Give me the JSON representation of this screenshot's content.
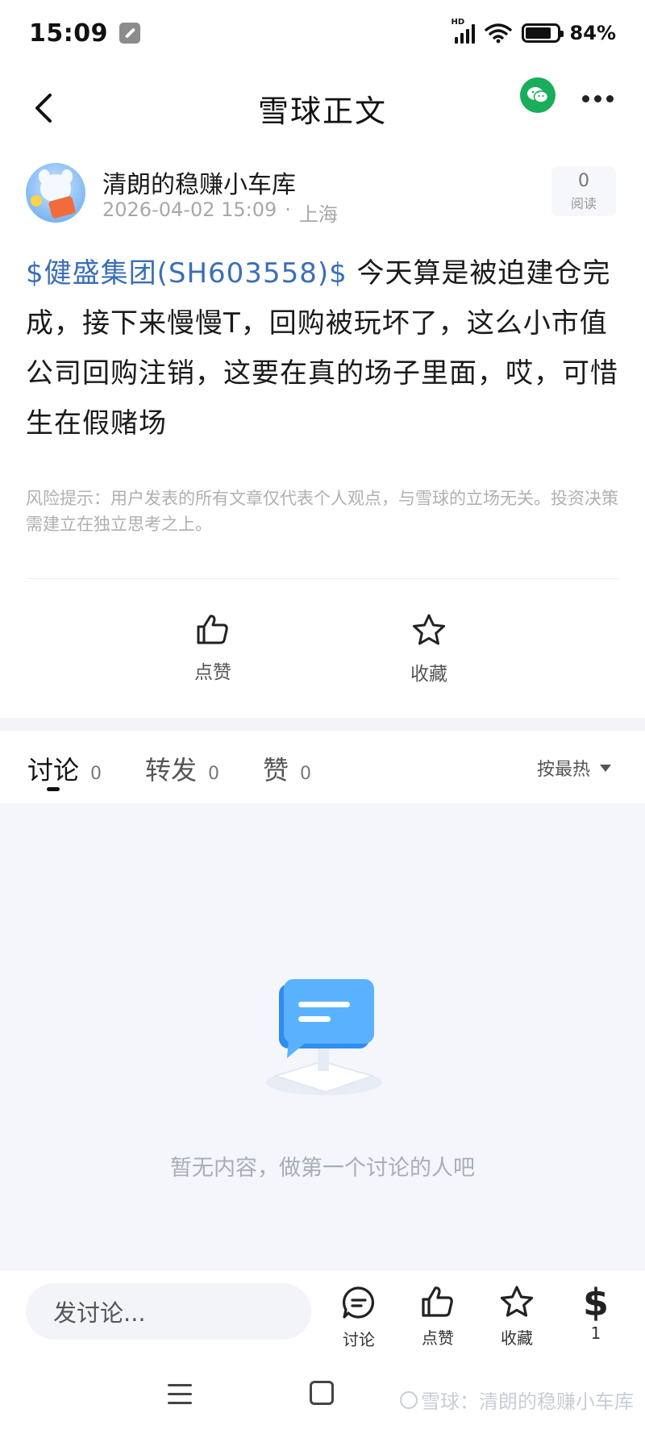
{
  "status_bar": {
    "time": "15:09",
    "network": "HD",
    "battery": "84%"
  },
  "header": {
    "title": "雪球正文"
  },
  "author": {
    "name": "清朗的稳赚小车库",
    "date": "2026-04-02 15:09",
    "separator": "·",
    "location": "上海",
    "read_count": "0",
    "read_label": "阅读"
  },
  "post": {
    "stock_tag": "$健盛集团(SH603558)$",
    "text": " 今天算是被迫建仓完成，接下来慢慢T，回购被玩坏了，这么小市值公司回购注销，这要在真的场子里面，哎，可惜生在假赌场"
  },
  "risk_note": "风险提示：用户发表的所有文章仅代表个人观点，与雪球的立场无关。投资决策需建立在独立思考之上。",
  "actions": {
    "like_label": "点赞",
    "favorite_label": "收藏"
  },
  "tabs": [
    {
      "label": "讨论",
      "count": "0"
    },
    {
      "label": "转发",
      "count": "0"
    },
    {
      "label": "赞",
      "count": "0"
    }
  ],
  "sort": {
    "label": "按最热"
  },
  "empty_state": {
    "text": "暂无内容，做第一个讨论的人吧"
  },
  "bottom_bar": {
    "input_placeholder": "发讨论...",
    "discuss_label": "讨论",
    "like_label": "点赞",
    "favorite_label": "收藏",
    "reward_symbol": "$",
    "reward_count": "1"
  },
  "watermark": {
    "text": "雪球：清朗的稳赚小车库"
  },
  "colors": {
    "stock_link": "#3a6fb8",
    "wechat_green": "#1aad5b",
    "empty_bg": "#f4f6fb"
  }
}
